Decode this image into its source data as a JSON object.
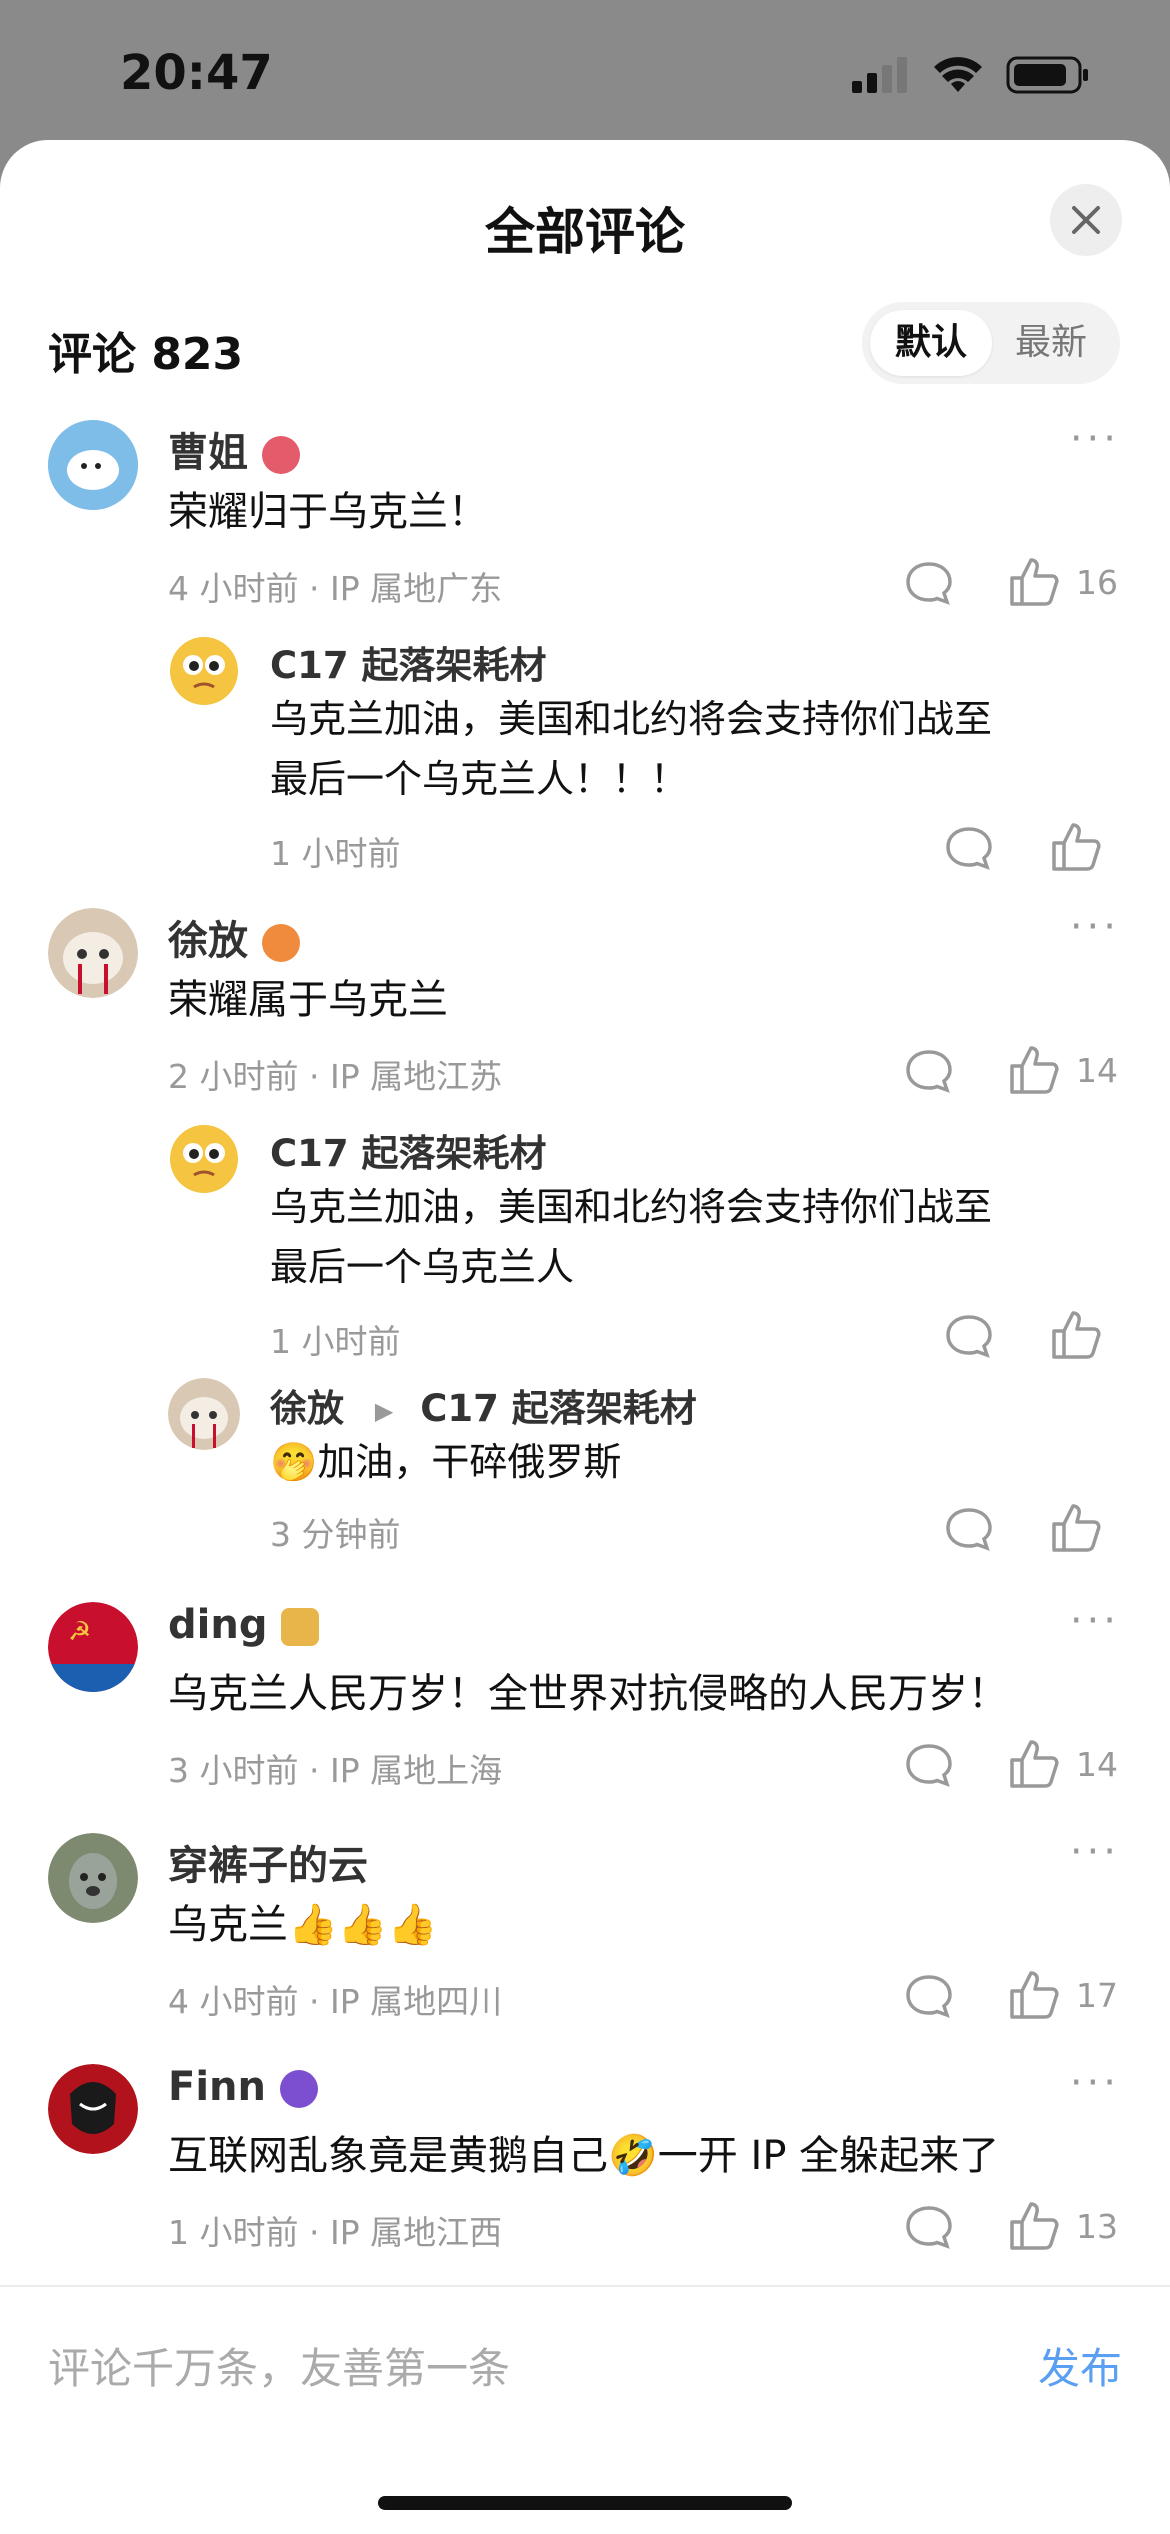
{
  "status_bar": {
    "time": "20:47"
  },
  "sheet": {
    "title": "全部评论",
    "count_label": "评论 823",
    "sort": {
      "default": "默认",
      "latest": "最新"
    }
  },
  "comments": [
    {
      "name": "曹姐",
      "text": "荣耀归于乌克兰！",
      "time": "4 小时前",
      "ip": "· IP 属地广东",
      "likes": "16"
    },
    {
      "name": "C17 起落架耗材",
      "text1": "乌克兰加油，美国和北约将会支持你们战至",
      "text2": "最后一个乌克兰人！！！",
      "time": "1 小时前"
    },
    {
      "name": "徐放",
      "text": "荣耀属于乌克兰",
      "time": "2 小时前",
      "ip": "· IP 属地江苏",
      "likes": "14"
    },
    {
      "name": "C17 起落架耗材",
      "text1": "乌克兰加油，美国和北约将会支持你们战至",
      "text2": "最后一个乌克兰人",
      "time": "1 小时前"
    },
    {
      "name": "徐放",
      "reply_to": "C17 起落架耗材",
      "text": "🤭加油，干碎俄罗斯",
      "time": "3 分钟前"
    },
    {
      "name": "ding",
      "text": "乌克兰人民万岁！全世界对抗侵略的人民万岁！",
      "time": "3 小时前",
      "ip": "· IP 属地上海",
      "likes": "14"
    },
    {
      "name": "穿裤子的云",
      "text": "乌克兰👍👍👍",
      "time": "4 小时前",
      "ip": "· IP 属地四川",
      "likes": "17"
    },
    {
      "name": "Finn",
      "text": "互联网乱象竟是黄鹅自己🤣一开 IP 全躲起来了",
      "time": "1 小时前",
      "ip": "· IP 属地江西",
      "likes": "13"
    }
  ],
  "footer": {
    "placeholder": "评论千万条，友善第一条",
    "publish": "发布"
  },
  "colors": {
    "accent": "#5b9ff2",
    "meta": "#999999"
  }
}
